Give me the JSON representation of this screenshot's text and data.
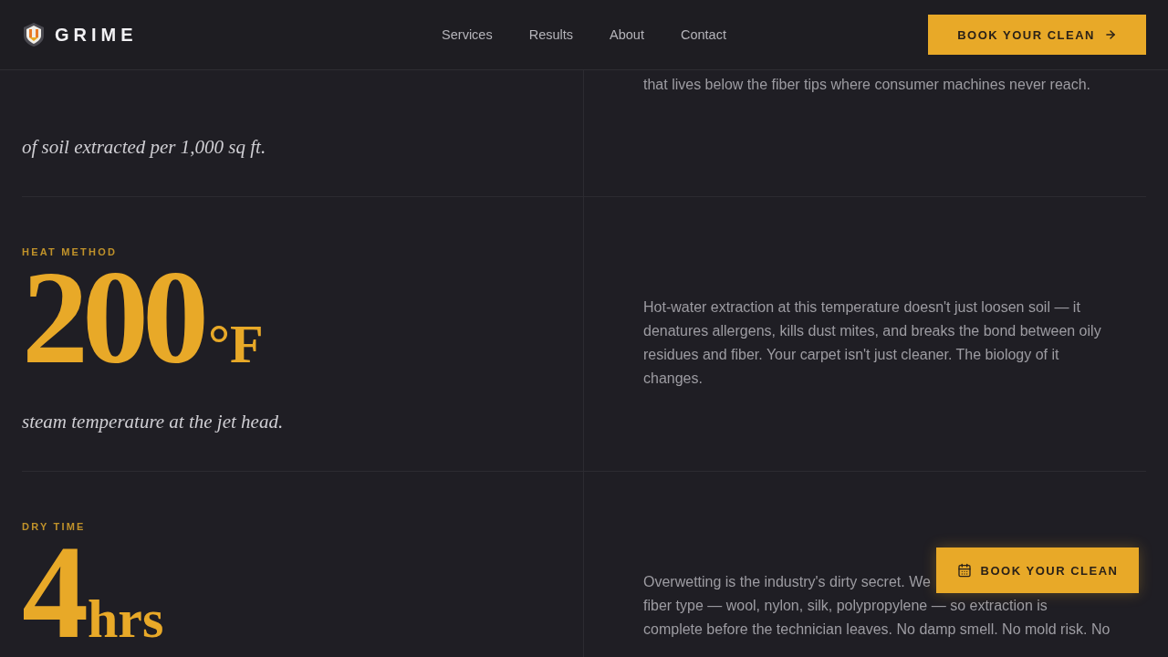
{
  "header": {
    "logo": "GRIME",
    "nav": [
      "Services",
      "Results",
      "About",
      "Contact"
    ],
    "cta": "BOOK YOUR CLEAN"
  },
  "stats": [
    {
      "caption": "of soil extracted per 1,000 sq ft.",
      "description": [
        "that lives below the fiber tips where consumer machines never reach."
      ]
    },
    {
      "label": "HEAT METHOD",
      "value": "200",
      "unit": "°F",
      "caption": "steam temperature at the jet head.",
      "description": [
        "Hot-water extraction at this temperature doesn't just loosen soil — it",
        "denatures allergens, kills dust mites, and breaks the bond between oily",
        "residues and fiber. Your carpet isn't just cleaner. The biology of it",
        "changes."
      ]
    },
    {
      "label": "DRY TIME",
      "value": "4",
      "unit": "hrs",
      "description": [
        "Overwetting is the industry's dirty secret. We",
        "fiber type — wool, nylon, silk, polypropylene — so extraction is",
        "complete before the technician leaves. No damp smell. No mold risk. No"
      ]
    }
  ],
  "floating_cta": "BOOK YOUR CLEAN"
}
